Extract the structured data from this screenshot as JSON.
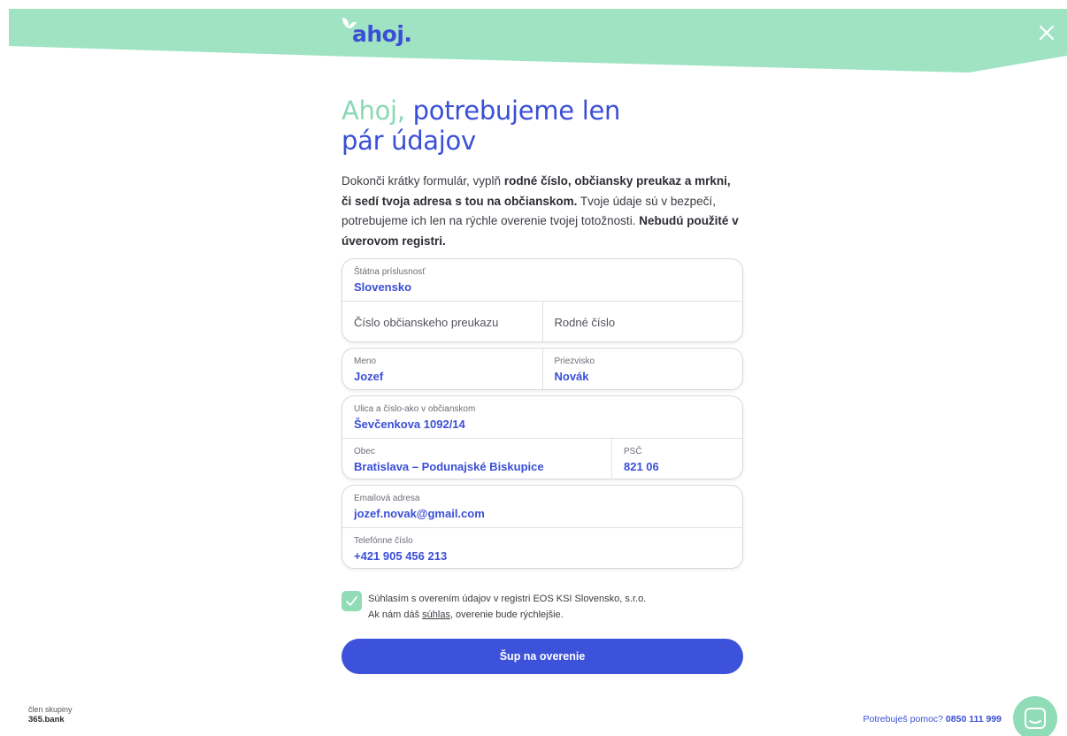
{
  "header": {
    "logo_text": "ahoj.",
    "close_label": "×"
  },
  "hero": {
    "greeting": "Ahoj,",
    "headline_rest": " potrebujeme len",
    "headline_line2": "pár údajov",
    "intro": {
      "t1": "Dokonči krátky formulár, vyplň ",
      "b1": "rodné číslo, občiansky preukaz a mrkni, či sedí tvoja adresa s tou na občianskom.",
      "t2": " Tvoje údaje sú v bezpečí, potrebujeme ich len na rýchle overenie tvojej totožnosti. ",
      "b2": "Nebudú použité v úverovom registri."
    }
  },
  "form": {
    "nationality": {
      "label": "Štátna príslusnosť",
      "value": "Slovensko"
    },
    "id_card": {
      "placeholder": "Číslo občianskeho preukazu"
    },
    "birth_number": {
      "placeholder": "Rodné číslo"
    },
    "first_name": {
      "label": "Meno",
      "value": "Jozef"
    },
    "last_name": {
      "label": "Priezvisko",
      "value": "Novák"
    },
    "street": {
      "label": "Ulica a číslo-ako v občianskom",
      "value": "Ševčenkova 1092/14"
    },
    "city": {
      "label": "Obec",
      "value": "Bratislava – Podunajské Biskupice"
    },
    "zip": {
      "label": "PSČ",
      "value": "821 06"
    },
    "email": {
      "label": "Emailová adresa",
      "value": "jozef.novak@gmail.com"
    },
    "phone": {
      "label": "Telefónne číslo",
      "value": "+421 905 456 213"
    }
  },
  "consent": {
    "checked": true,
    "line1": "Súhlasím s overením údajov v registri EOS KSI Slovensko, s.r.o.",
    "line2_before": "Ak nám dáš ",
    "line2_link": "súhlas",
    "line2_after": ", overenie bude rýchlejšie."
  },
  "submit_label": "Šup na overenie",
  "footer": {
    "member_text": "člen skupiny",
    "group_brand": "365.bank",
    "help_text": "Potrebuješ pomoc? ",
    "help_phone": "0850 111 999"
  },
  "colors": {
    "brand_blue": "#3a4fd6",
    "mint": "#9fe3c3",
    "button": "#3d52da"
  }
}
